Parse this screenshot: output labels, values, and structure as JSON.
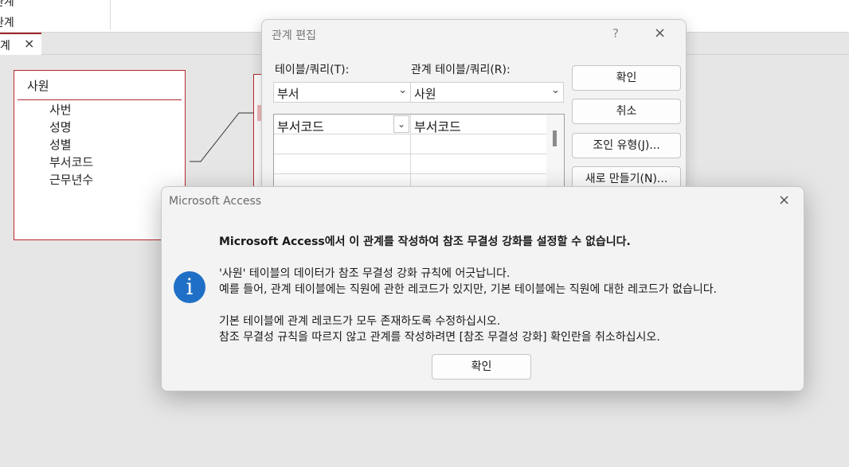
{
  "nav": {
    "item1": "관계",
    "item2": "관계"
  },
  "doc_tab": {
    "label": "계",
    "close": "×"
  },
  "table_box": {
    "title": "사원",
    "fields": [
      "사번",
      "성명",
      "성별",
      "부서코드",
      "근무년수"
    ]
  },
  "relation_dialog": {
    "title": "관계 편집",
    "help": "?",
    "close": "×",
    "table_label": "테이블/쿼리(T):",
    "related_label": "관계 테이블/쿼리(R):",
    "table_value": "부서",
    "related_value": "사원",
    "grid": {
      "left_field": "부서코드",
      "right_field": "부서코드"
    },
    "buttons": {
      "ok": "확인",
      "cancel": "취소",
      "join": "조인 유형(J)...",
      "new": "새로 만들기(N)..."
    }
  },
  "message": {
    "title": "Microsoft Access",
    "close": "×",
    "icon": "i",
    "heading": "Microsoft Access에서 이 관계를 작성하여 참조 무결성 강화를 설정할 수 없습니다.",
    "line1": "'사원' 테이블의 데이터가 참조 무결성 강화 규칙에 어긋납니다.",
    "line2": "예를 들어, 관계 테이블에는 직원에 관한 레코드가 있지만, 기본 테이블에는 직원에 대한 레코드가 없습니다.",
    "line3": "기본 테이블에 관계 레코드가 모두 존재하도록 수정하십시오.",
    "line4": "참조 무결성 규칙을 따르지 않고 관계를 작성하려면 [참조 무결성 강화] 확인란을 취소하십시오.",
    "ok": "확인"
  }
}
